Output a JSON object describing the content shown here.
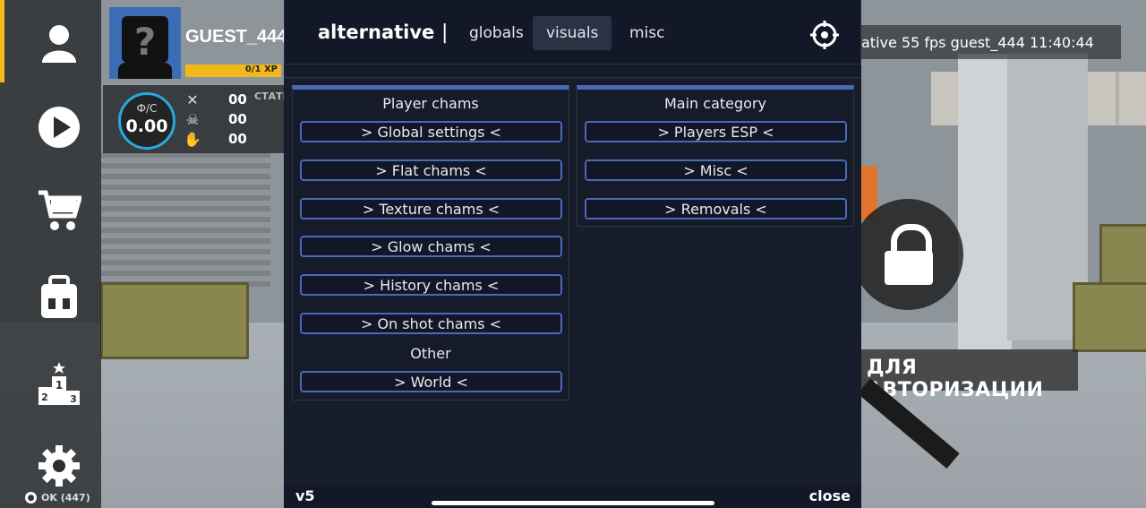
{
  "menu": {
    "title": "alternative",
    "separator": "|",
    "tabs": [
      {
        "label": "globals",
        "active": false
      },
      {
        "label": "visuals",
        "active": true
      },
      {
        "label": "misc",
        "active": false
      }
    ],
    "settings_icon": "crosshair-gear-icon",
    "groups": {
      "player_chams": {
        "title": "Player chams",
        "buttons": [
          "> Global settings <",
          "> Flat chams <",
          "> Texture chams <",
          "> Glow chams <",
          "> History chams <",
          "> On shot chams <"
        ],
        "other_title": "Other",
        "other_buttons": [
          "> World <"
        ]
      },
      "main_category": {
        "title": "Main category",
        "buttons": [
          "> Players ESP <",
          "> Misc <",
          "> Removals <"
        ]
      }
    },
    "footer": {
      "version": "v5",
      "close": "close"
    }
  },
  "game": {
    "player": {
      "name": "GUEST_444",
      "xp_text": "0/1 XP",
      "xp_progress": 0.0
    },
    "stats": {
      "fc_label": "Ф/С",
      "fc_value": "0.00",
      "kills": "00",
      "deaths": "00",
      "assists": "00",
      "stats_label": "СТАТИ"
    },
    "info_bar": "ative 55 fps guest_444 11:40:44",
    "auth_banner": "ДЛЯ АВТОРИЗАЦИИ",
    "ok_label": "OK (447)"
  },
  "sidebar": {
    "icons": [
      "profile-icon",
      "play-icon",
      "shop-cart-icon",
      "backpack-icon",
      "leaderboard-icon",
      "settings-gear-icon"
    ]
  },
  "colors": {
    "accent_yellow": "#f3b81a",
    "menu_bg": "#141a27",
    "button_border": "#4a69b7",
    "fc_ring": "#29a8e0"
  }
}
